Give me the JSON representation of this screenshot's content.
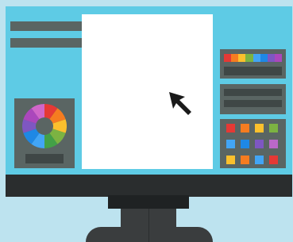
{
  "colors": {
    "background": "#bde3ef",
    "screen": "#5ecbe5",
    "panel": "#5a6563",
    "panel_dark": "#3f4746",
    "bezel": "#2a2d2e",
    "canvas": "#ffffff"
  },
  "color_wheel": {
    "segments": [
      "#e53935",
      "#f57c20",
      "#fbc02d",
      "#7cb342",
      "#43a047",
      "#42a5f5",
      "#1e88e5",
      "#7e57c2",
      "#ab47bc",
      "#d066c9"
    ]
  },
  "spectrum_strip": [
    "#e53935",
    "#f57c20",
    "#fbc02d",
    "#7cb342",
    "#42a5f5",
    "#1e88e5",
    "#7e57c2",
    "#ab47bc"
  ],
  "swatch_palette": [
    "#e53935",
    "#f57c20",
    "#fbc02d",
    "#7cb342",
    "#42a5f5",
    "#1e88e5",
    "#7e57c2",
    "#ba68c8",
    "#fbc02d",
    "#f57c20",
    "#42a5f5",
    "#e53935"
  ],
  "icons": {
    "pointer": "cursor-arrow-icon",
    "wheel": "color-wheel-icon"
  }
}
